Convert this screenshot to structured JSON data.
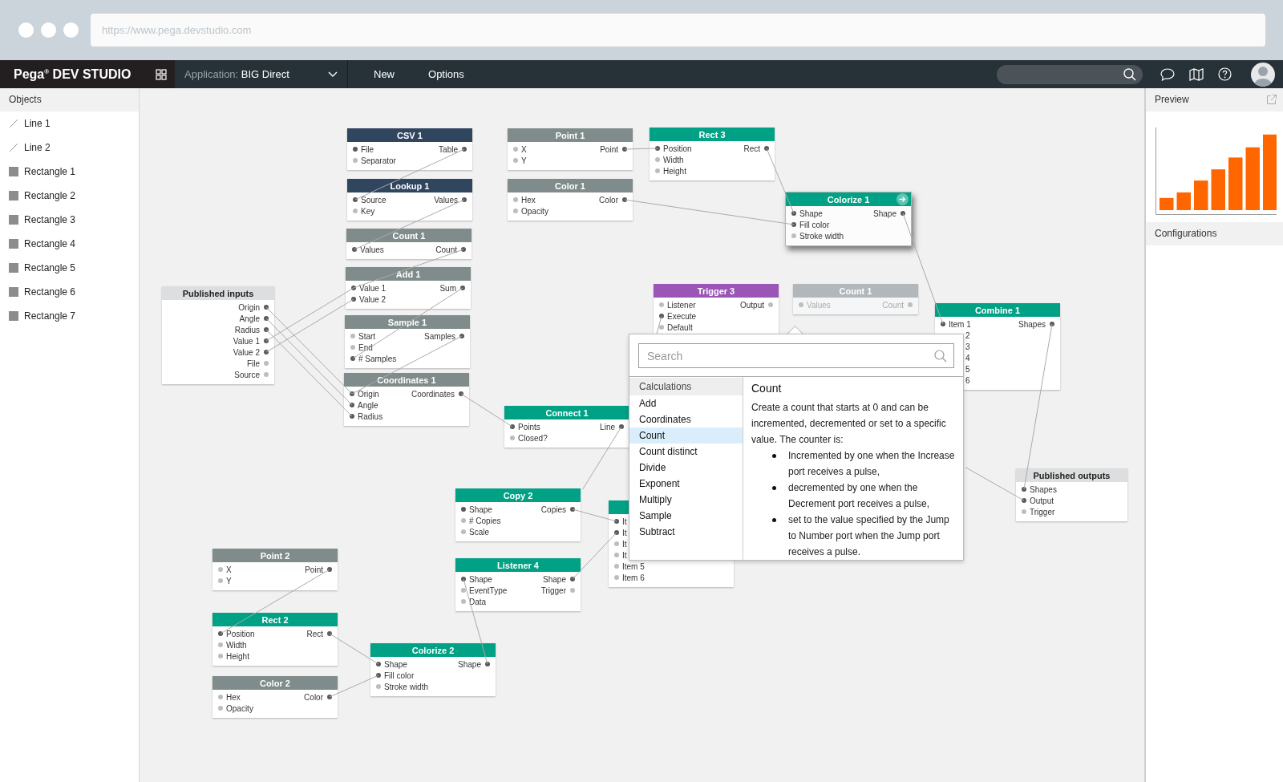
{
  "browser": {
    "url": "https://www.pega.devstudio.com"
  },
  "appbar": {
    "logo": "Pega$^{®}$ DEV STUDIO",
    "application": {
      "label": "Application:",
      "value": "BIG Direct"
    },
    "menu": [
      "New",
      "Options"
    ]
  },
  "sidebar": {
    "title": "Objects",
    "items": [
      {
        "label": "Line 1",
        "kind": "line"
      },
      {
        "label": "Line 2",
        "kind": "line"
      },
      {
        "label": "Rectangle 1",
        "kind": "rect"
      },
      {
        "label": "Rectangle 2",
        "kind": "rect"
      },
      {
        "label": "Rectangle 3",
        "kind": "rect"
      },
      {
        "label": "Rectangle 4",
        "kind": "rect"
      },
      {
        "label": "Rectangle 5",
        "kind": "rect"
      },
      {
        "label": "Rectangle 6",
        "kind": "rect"
      },
      {
        "label": "Rectangle 7",
        "kind": "rect"
      }
    ]
  },
  "nodes": [
    {
      "title": "Published inputs",
      "kind": "published",
      "color": "#dcdedf",
      "selected": false,
      "disabled": false,
      "outputs": [
        {
          "label": "Origin",
          "connected": true
        },
        {
          "label": "Angle",
          "connected": true
        },
        {
          "label": "Radius",
          "connected": true
        },
        {
          "label": "Value 1",
          "connected": true
        },
        {
          "label": "Value 2",
          "connected": true
        },
        {
          "label": "File",
          "connected": false
        },
        {
          "label": "Source",
          "connected": false
        }
      ]
    },
    {
      "title": "CSV 1",
      "kind": "node",
      "color": "#30455e",
      "selected": false,
      "disabled": false,
      "inputs": [
        {
          "label": "File",
          "connected": true
        },
        {
          "label": "Separator",
          "connected": false
        }
      ],
      "outputs": [
        {
          "label": "Table",
          "connected": true
        }
      ]
    },
    {
      "title": "Lookup 1",
      "kind": "node",
      "color": "#30455e",
      "selected": false,
      "disabled": false,
      "inputs": [
        {
          "label": "Source",
          "connected": true
        },
        {
          "label": "Key",
          "connected": false
        }
      ],
      "outputs": [
        {
          "label": "Values",
          "connected": true
        }
      ]
    },
    {
      "title": "Count 1",
      "kind": "node",
      "color": "#7f8c8b",
      "selected": false,
      "disabled": false,
      "inputs": [
        {
          "label": "Values",
          "connected": true
        }
      ],
      "outputs": [
        {
          "label": "Count",
          "connected": true
        }
      ]
    },
    {
      "title": "Add 1",
      "kind": "node",
      "color": "#7f8c8b",
      "selected": false,
      "disabled": false,
      "inputs": [
        {
          "label": "Value 1",
          "connected": true
        },
        {
          "label": "Value 2",
          "connected": true
        }
      ],
      "outputs": [
        {
          "label": "Sum",
          "connected": true
        }
      ]
    },
    {
      "title": "Sample 1",
      "kind": "node",
      "color": "#7f8c8b",
      "selected": false,
      "disabled": false,
      "inputs": [
        {
          "label": "Start",
          "connected": false
        },
        {
          "label": "End",
          "connected": false
        },
        {
          "label": "# Samples",
          "connected": true
        }
      ],
      "outputs": [
        {
          "label": "Samples",
          "connected": true
        }
      ]
    },
    {
      "title": "Coordinates 1",
      "kind": "node",
      "color": "#7f8c8b",
      "selected": false,
      "disabled": false,
      "inputs": [
        {
          "label": "Origin",
          "connected": true
        },
        {
          "label": "Angle",
          "connected": true
        },
        {
          "label": "Radius",
          "connected": true
        }
      ],
      "outputs": [
        {
          "label": "Coordinates",
          "connected": true
        }
      ]
    },
    {
      "title": "Point 1",
      "kind": "node",
      "color": "#7f8c8b",
      "selected": false,
      "disabled": false,
      "inputs": [
        {
          "label": "X",
          "connected": false
        },
        {
          "label": "Y",
          "connected": false
        }
      ],
      "outputs": [
        {
          "label": "Point",
          "connected": true
        }
      ]
    },
    {
      "title": "Color 1",
      "kind": "node",
      "color": "#7f8c8b",
      "selected": false,
      "disabled": false,
      "inputs": [
        {
          "label": "Hex",
          "connected": false
        },
        {
          "label": "Opacity",
          "connected": false
        }
      ],
      "outputs": [
        {
          "label": "Color",
          "connected": true
        }
      ]
    },
    {
      "title": "Rect 3",
      "kind": "node",
      "color": "#00a184",
      "selected": false,
      "disabled": false,
      "inputs": [
        {
          "label": "Position",
          "connected": true
        },
        {
          "label": "Width",
          "connected": false
        },
        {
          "label": "Height",
          "connected": false
        }
      ],
      "outputs": [
        {
          "label": "Rect",
          "connected": true
        }
      ]
    },
    {
      "title": "Colorize 1",
      "kind": "node",
      "color": "#00a184",
      "selected": true,
      "disabled": false,
      "inputs": [
        {
          "label": "Shape",
          "connected": true
        },
        {
          "label": "Fill color",
          "connected": true
        },
        {
          "label": "Stroke width",
          "connected": false
        }
      ],
      "outputs": [
        {
          "label": "Shape",
          "connected": true
        }
      ]
    },
    {
      "title": "Trigger 3",
      "kind": "node",
      "color": "#9b55b7",
      "selected": false,
      "disabled": false,
      "inputs": [
        {
          "label": "Listener",
          "connected": false
        },
        {
          "label": "Execute",
          "connected": true
        },
        {
          "label": "Default",
          "connected": false
        }
      ],
      "outputs": [
        {
          "label": "Output",
          "connected": false
        }
      ]
    },
    {
      "title": "Count 1",
      "kind": "node",
      "color": "#b2b7bc",
      "selected": false,
      "disabled": true,
      "inputs": [
        {
          "label": "Values"
        }
      ],
      "outputs": [
        {
          "label": "Count"
        }
      ]
    },
    {
      "title": "Combine 1",
      "kind": "node",
      "color": "#00a184",
      "selected": false,
      "disabled": false,
      "inputs": [
        {
          "label": "Item 1",
          "kind": "port",
          "connected": true
        },
        {
          "label": "2",
          "kind": "covered"
        },
        {
          "label": "3",
          "kind": "covered"
        },
        {
          "label": "4",
          "kind": "covered"
        },
        {
          "label": "5",
          "kind": "covered"
        },
        {
          "label": "6",
          "kind": "covered"
        }
      ],
      "outputs": [
        {
          "label": "Shapes",
          "connected": true
        }
      ]
    },
    {
      "title": "Connect 1",
      "kind": "node",
      "color": "#00a184",
      "selected": false,
      "disabled": false,
      "inputs": [
        {
          "label": "Points",
          "connected": true
        },
        {
          "label": "Closed?",
          "connected": false
        }
      ],
      "outputs": [
        {
          "label": "Line",
          "connected": true
        }
      ]
    },
    {
      "title": "Copy 2",
      "kind": "node",
      "color": "#00a184",
      "selected": false,
      "disabled": false,
      "inputs": [
        {
          "label": "Shape",
          "connected": true
        },
        {
          "label": "# Copies",
          "connected": false
        },
        {
          "label": "Scale",
          "connected": false
        }
      ],
      "outputs": [
        {
          "label": "Copies",
          "connected": true
        }
      ]
    },
    {
      "title": "Listener 4",
      "kind": "node",
      "color": "#00a184",
      "selected": false,
      "disabled": false,
      "inputs": [
        {
          "label": "Shape",
          "connected": true
        },
        {
          "label": "EventType",
          "connected": false
        },
        {
          "label": "Data",
          "connected": false
        }
      ],
      "outputs": [
        {
          "label": "Shape",
          "connected": true
        },
        {
          "label": "Trigger",
          "connected": false
        }
      ]
    },
    {
      "kind": "node",
      "color": "#00a184",
      "selected": false,
      "disabled": false,
      "inputs": [
        {
          "label": "It",
          "connected": true
        },
        {
          "label": "It",
          "connected": true
        },
        {
          "label": "It",
          "connected": false
        },
        {
          "label": "It",
          "connected": false
        },
        {
          "label": "Item 5",
          "connected": false
        },
        {
          "label": "Item 6",
          "connected": false
        }
      ]
    },
    {
      "title": "Published outputs",
      "kind": "published",
      "color": "#dcdedf",
      "selected": false,
      "disabled": false,
      "inputs": [
        {
          "label": "Shapes",
          "connected": true
        },
        {
          "label": "Output",
          "connected": true
        },
        {
          "label": "Trigger",
          "connected": false
        }
      ]
    },
    {
      "title": "Point 2",
      "kind": "node",
      "color": "#7f8c8b",
      "selected": false,
      "disabled": false,
      "inputs": [
        {
          "label": "X",
          "connected": false
        },
        {
          "label": "Y",
          "connected": false
        }
      ],
      "outputs": [
        {
          "label": "Point",
          "connected": true
        }
      ]
    },
    {
      "title": "Rect 2",
      "kind": "node",
      "color": "#00a184",
      "selected": false,
      "disabled": false,
      "inputs": [
        {
          "label": "Position",
          "connected": true
        },
        {
          "label": "Width",
          "connected": false
        },
        {
          "label": "Height",
          "connected": false
        }
      ],
      "outputs": [
        {
          "label": "Rect",
          "connected": true
        }
      ]
    },
    {
      "title": "Color 2",
      "kind": "node",
      "color": "#7f8c8b",
      "selected": false,
      "disabled": false,
      "inputs": [
        {
          "label": "Hex",
          "connected": false
        },
        {
          "label": "Opacity",
          "connected": false
        }
      ],
      "outputs": [
        {
          "label": "Color",
          "connected": true
        }
      ]
    },
    {
      "title": "Colorize 2",
      "kind": "node",
      "color": "#00a184",
      "selected": false,
      "disabled": false,
      "inputs": [
        {
          "label": "Shape",
          "connected": true
        },
        {
          "label": "Fill color",
          "connected": true
        },
        {
          "label": "Stroke width",
          "connected": false
        }
      ],
      "outputs": [
        {
          "label": "Shape",
          "connected": true
        }
      ]
    }
  ],
  "popup": {
    "search": {
      "placeholder": "Search"
    },
    "category": "Calculations",
    "items": [
      {
        "label": "Add",
        "selected": false
      },
      {
        "label": "Coordinates",
        "selected": false
      },
      {
        "label": "Count",
        "selected": true
      },
      {
        "label": "Count distinct",
        "selected": false
      },
      {
        "label": "Divide",
        "selected": false
      },
      {
        "label": "Exponent",
        "selected": false
      },
      {
        "label": "Multiply",
        "selected": false
      },
      {
        "label": "Sample",
        "selected": false
      },
      {
        "label": "Subtract",
        "selected": false
      }
    ],
    "detail": {
      "title": "Count",
      "text": "Create a count that starts at 0 and can be incremented, decremented or set to a specific value. The counter is:",
      "bullets": [
        "Incremented by one when the Increase port receives a pulse,",
        "decremented by one when the Decrement port receives a pulse,",
        "set to the value specified by the Jump to Number port when the Jump port receives a pulse."
      ]
    }
  },
  "right_panel": {
    "preview_title": "Preview",
    "config_title": "Configurations"
  }
}
